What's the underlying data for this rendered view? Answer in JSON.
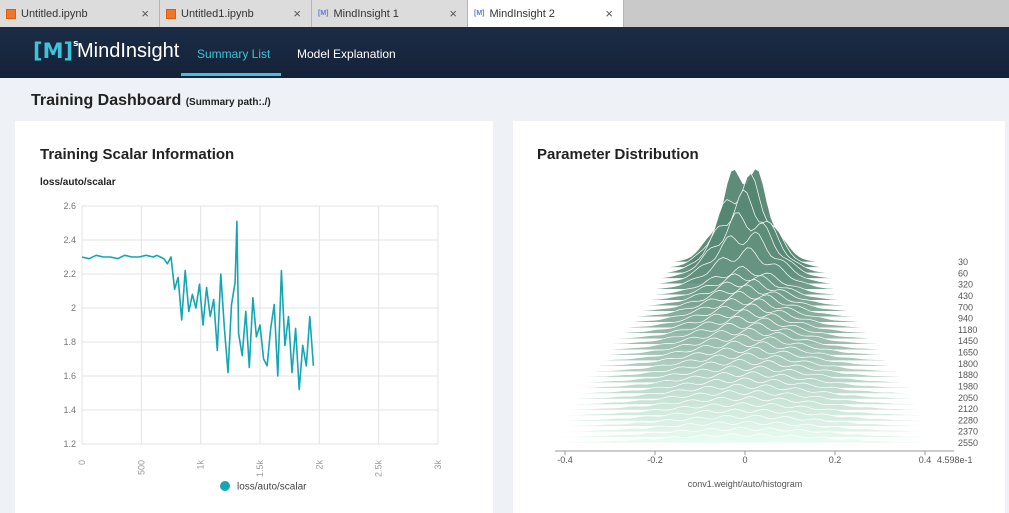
{
  "browser": {
    "tabs": [
      {
        "label": "Untitled.ipynb",
        "icon": "jupyter-notebook-icon",
        "close": "×"
      },
      {
        "label": "Untitled1.ipynb",
        "icon": "jupyter-notebook-icon",
        "close": "×"
      },
      {
        "label": "MindInsight 1",
        "icon": "mindinsight-icon",
        "close": "×"
      },
      {
        "label": "MindInsight 2",
        "icon": "mindinsight-icon",
        "close": "×",
        "active": true
      }
    ],
    "mi_icon_text": "[M]"
  },
  "header": {
    "logo_mark": "[M]",
    "logo_sup": "s",
    "app_name": "MindInsight",
    "nav": [
      {
        "label": "Summary List",
        "active": true
      },
      {
        "label": "Model Explanation"
      }
    ]
  },
  "page": {
    "title": "Training Dashboard",
    "subtitle": "(Summary path:./)"
  },
  "scalar_card": {
    "title": "Training Scalar Information",
    "metric": "loss/auto/scalar"
  },
  "histogram_card": {
    "title": "Parameter Distribution"
  },
  "colors": {
    "accent": "#3fc3d8",
    "line": "#14a6b1",
    "header": "#1c2c46"
  },
  "chart_data": [
    {
      "type": "line",
      "xlim": [
        0,
        3000
      ],
      "ylim": [
        1.2,
        2.6
      ],
      "x_ticks": [
        "0",
        "500",
        "1k",
        "1.5k",
        "2k",
        "2.5k",
        "3k"
      ],
      "y_ticks": [
        "1.2",
        "1.4",
        "1.6",
        "1.8",
        "2",
        "2.2",
        "2.4",
        "2.6"
      ],
      "grid": true,
      "legend": "bottom-center",
      "series": [
        {
          "name": "loss/auto/scalar",
          "x": [
            0,
            60,
            120,
            180,
            240,
            300,
            360,
            420,
            480,
            540,
            600,
            630,
            660,
            690,
            720,
            750,
            780,
            810,
            840,
            870,
            900,
            930,
            960,
            990,
            1020,
            1050,
            1080,
            1110,
            1140,
            1170,
            1200,
            1230,
            1260,
            1290,
            1305,
            1320,
            1350,
            1380,
            1410,
            1440,
            1470,
            1500,
            1530,
            1560,
            1590,
            1620,
            1650,
            1680,
            1710,
            1740,
            1770,
            1800,
            1830,
            1860,
            1890,
            1920,
            1950
          ],
          "y": [
            2.3,
            2.29,
            2.31,
            2.3,
            2.3,
            2.29,
            2.31,
            2.3,
            2.3,
            2.31,
            2.3,
            2.31,
            2.3,
            2.29,
            2.26,
            2.3,
            2.11,
            2.18,
            1.93,
            2.22,
            1.98,
            2.08,
            2.0,
            2.14,
            1.9,
            2.12,
            1.95,
            2.05,
            1.75,
            2.2,
            1.88,
            1.62,
            2.02,
            2.15,
            2.51,
            1.85,
            1.72,
            1.98,
            1.65,
            2.06,
            1.83,
            1.9,
            1.7,
            1.66,
            1.88,
            2.02,
            1.6,
            2.22,
            1.78,
            1.95,
            1.62,
            1.88,
            1.52,
            1.78,
            1.66,
            1.95,
            1.66
          ]
        }
      ]
    },
    {
      "type": "area",
      "x_ticks": [
        "-0.4",
        "-0.2",
        "0",
        "0.2",
        "0.4"
      ],
      "x_extra_label": "4.598e-1",
      "y_ticks": [
        "30",
        "60",
        "320",
        "430",
        "700",
        "940",
        "1180",
        "1450",
        "1650",
        "1800",
        "1880",
        "1980",
        "2050",
        "2120",
        "2280",
        "2370",
        "2550"
      ],
      "xlabel": "conv1.weight/auto/histogram"
    }
  ]
}
